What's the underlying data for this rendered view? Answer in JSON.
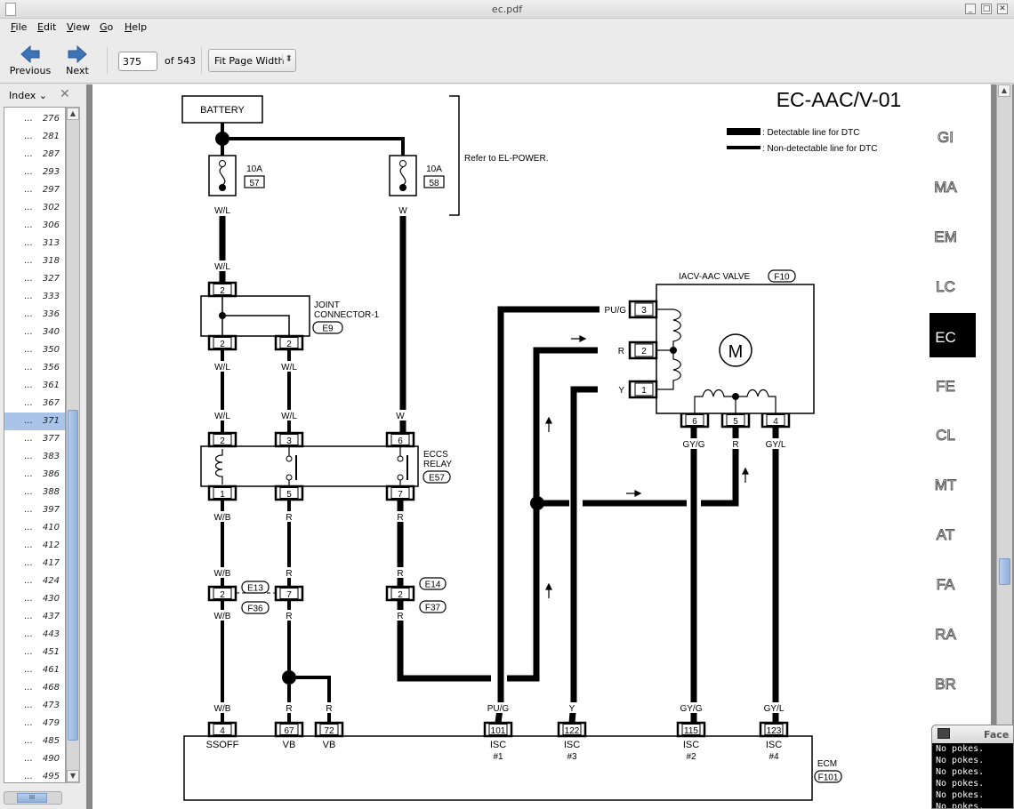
{
  "window": {
    "title": "ec.pdf",
    "controls": [
      "_",
      "□",
      "✕"
    ]
  },
  "menu": [
    "File",
    "Edit",
    "View",
    "Go",
    "Help"
  ],
  "toolbar": {
    "previous": "Previous",
    "next": "Next",
    "page": "375",
    "of": "of 543",
    "zoom": "Fit Page Width",
    "zoom_arrows": "⬍"
  },
  "sidebar": {
    "mode": "Index",
    "close": "✕",
    "selected": "371",
    "items": [
      "276",
      "281",
      "287",
      "293",
      "297",
      "302",
      "306",
      "313",
      "318",
      "327",
      "333",
      "336",
      "340",
      "350",
      "356",
      "361",
      "367",
      "371",
      "377",
      "383",
      "386",
      "388",
      "397",
      "410",
      "412",
      "417",
      "424",
      "430",
      "437",
      "443",
      "451",
      "461",
      "468",
      "473",
      "479",
      "485",
      "490",
      "495"
    ],
    "dots": "...",
    "hscroll_grip": "III"
  },
  "colors": {
    "accent": "#a9c4e8",
    "scroll": "#8fb0dd"
  },
  "diagram": {
    "title": "EC-AAC/V-01",
    "legend": {
      "detectable": ": Detectable line for DTC",
      "non_detectable": ": Non-detectable line for DTC"
    },
    "battery": "BATTERY",
    "refer": "Refer to EL-POWER.",
    "fuses": [
      {
        "amp": "10A",
        "num": "57"
      },
      {
        "amp": "10A",
        "num": "58"
      }
    ],
    "joint_connector": {
      "line1": "JOINT",
      "line2": "CONNECTOR-1",
      "id": "E9"
    },
    "relay": {
      "line1": "ECCS",
      "line2": "RELAY",
      "id": "E57"
    },
    "valve": {
      "name": "IACV-AAC VALVE",
      "id": "F10",
      "motor": "M",
      "pins": [
        "3",
        "2",
        "1"
      ]
    },
    "ecm": {
      "name": "ECM",
      "id": "F101"
    },
    "connector_ids": [
      "E13",
      "F36",
      "E14",
      "F37"
    ],
    "wire_labels": [
      "W/L",
      "W",
      "W/L",
      "W/L",
      "W/L",
      "W/L",
      "W/L",
      "W",
      "W/B",
      "R",
      "R",
      "W/B",
      "R",
      "R",
      "W/B",
      "R",
      "R",
      "W/B",
      "R",
      "R",
      "PU/G",
      "Y",
      "GY/G",
      "GY/L",
      "PU/G",
      "R",
      "Y",
      "GY/G",
      "R",
      "GY/L"
    ],
    "pins": [
      "2",
      "2",
      "2",
      "2",
      "3",
      "6",
      "1",
      "5",
      "7",
      "2",
      "7",
      "2",
      "6",
      "5",
      "4"
    ],
    "ecm_terminals": [
      {
        "pin": "4",
        "label": "SSOFF",
        "sub": ""
      },
      {
        "pin": "67",
        "label": "VB",
        "sub": ""
      },
      {
        "pin": "72",
        "label": "VB",
        "sub": ""
      },
      {
        "pin": "101",
        "label": "ISC",
        "sub": "#1"
      },
      {
        "pin": "122",
        "label": "ISC",
        "sub": "#3"
      },
      {
        "pin": "115",
        "label": "ISC",
        "sub": "#2"
      },
      {
        "pin": "123",
        "label": "ISC",
        "sub": "#4"
      }
    ]
  },
  "section_tabs": [
    "GI",
    "MA",
    "EM",
    "LC",
    "EC",
    "FE",
    "CL",
    "MT",
    "AT",
    "FA",
    "RA",
    "BR"
  ],
  "active_tab": "EC",
  "terminal": {
    "title": "Face",
    "lines": [
      "No pokes.",
      "No pokes.",
      "No pokes.",
      "No pokes.",
      "No pokes.",
      "No pokes."
    ]
  }
}
